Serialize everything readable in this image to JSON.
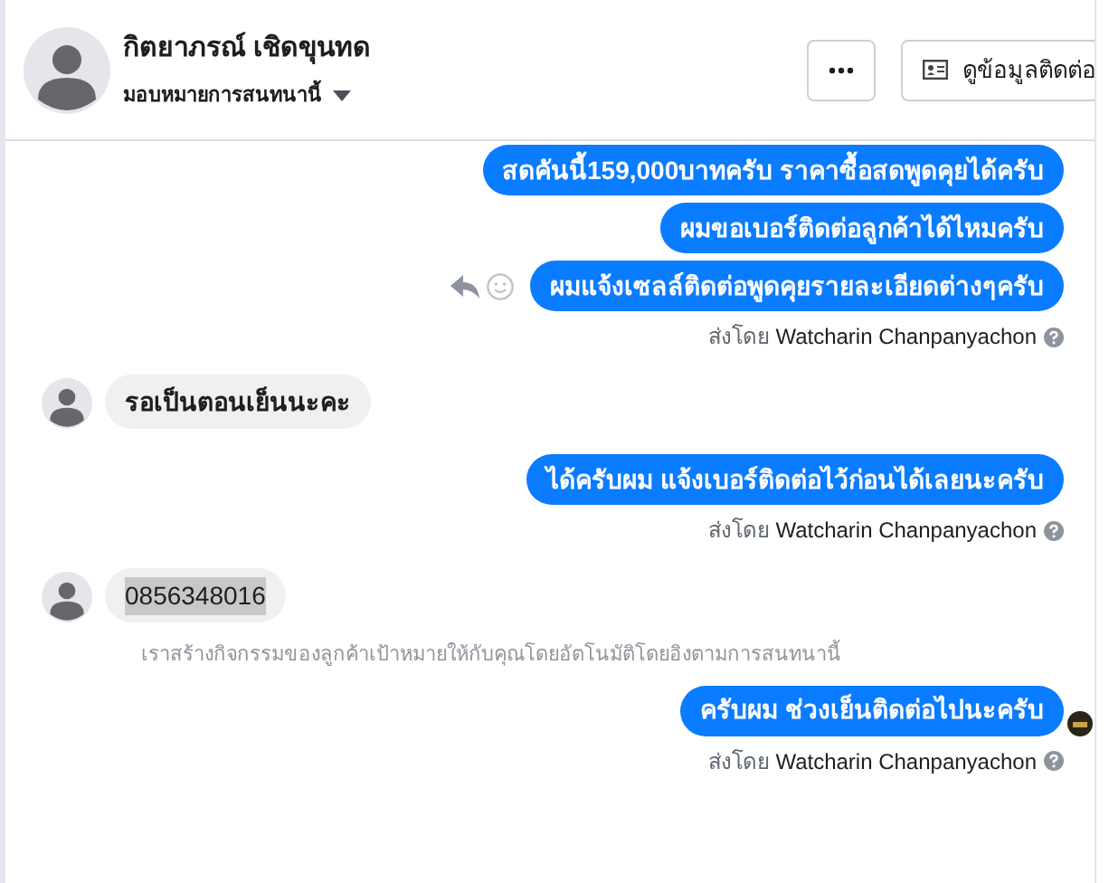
{
  "header": {
    "name": "กิตยาภรณ์ เชิดขุนทด",
    "subtitle": "มอบหมายการสนทนานี้",
    "contact_button": "ดูข้อมูลติดต่อ"
  },
  "messages": [
    {
      "kind": "outgoing",
      "text": "สดคันนี้159,000บาทครับ ราคาซื้อสดพูดคุยได้ครับ",
      "show_actions": false,
      "seen": false
    },
    {
      "kind": "outgoing",
      "text": "ผมขอเบอร์ติดต่อลูกค้าได้ไหมครับ",
      "show_actions": false,
      "seen": false
    },
    {
      "kind": "outgoing",
      "text": "ผมแจ้งเซลล์ติดต่อพูดคุยรายละเอียดต่างๆครับ",
      "show_actions": true,
      "seen": false
    },
    {
      "kind": "sender",
      "prefix": "ส่งโดย",
      "name": "Watcharin Chanpanyachon"
    },
    {
      "kind": "incoming",
      "text": "รอเป็นตอนเย็นนะคะ",
      "highlighted": false
    },
    {
      "kind": "outgoing",
      "text": "ได้ครับผม แจ้งเบอร์ติดต่อไว้ก่อนได้เลยนะครับ",
      "show_actions": false,
      "seen": false
    },
    {
      "kind": "sender",
      "prefix": "ส่งโดย",
      "name": "Watcharin Chanpanyachon"
    },
    {
      "kind": "incoming",
      "text": "0856348016",
      "highlighted": true
    },
    {
      "kind": "system",
      "text": "เราสร้างกิจกรรมของลูกค้าเป้าหมายให้กับคุณโดยอัตโนมัติโดยอิงตามการสนทนานี้"
    },
    {
      "kind": "outgoing",
      "text": "ครับผม ช่วงเย็นติดต่อไปนะครับ",
      "show_actions": false,
      "seen": true
    },
    {
      "kind": "sender",
      "prefix": "ส่งโดย",
      "name": "Watcharin Chanpanyachon"
    }
  ]
}
